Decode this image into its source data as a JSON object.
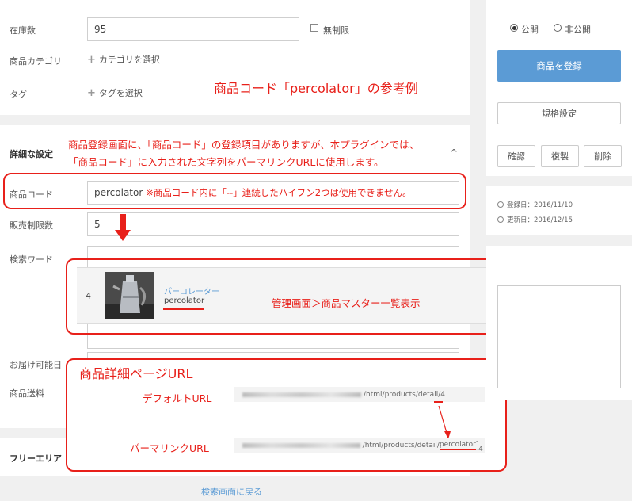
{
  "form": {
    "stock_label": "在庫数",
    "stock_value": "95",
    "unlimited_label": "無制限",
    "category_label": "商品カテゴリ",
    "category_link": "カテゴリを選択",
    "tag_label": "タグ",
    "tag_link": "タグを選択",
    "detail_section_title": "詳細な設定",
    "product_code_label": "商品コード",
    "product_code_value": "percolator",
    "sale_limit_label": "販売制限数",
    "sale_limit_value": "5",
    "search_word_label": "検索ワード",
    "delivery_label": "お届け可能日",
    "shipping_label": "商品送料",
    "free_area_label": "フリーエリア",
    "back_link": "検索画面に戻る"
  },
  "sidebar": {
    "public_label": "公開",
    "private_label": "非公開",
    "register_button": "商品を登録",
    "spec_button": "規格設定",
    "confirm_button": "確認",
    "copy_button": "複製",
    "delete_button": "削除",
    "created_label": "登録日：2016/11/10",
    "updated_label": "更新日：2016/12/15"
  },
  "product_row": {
    "id": "4",
    "name": "パーコレーター",
    "code": "percolator",
    "menu": "•••"
  },
  "annotations": {
    "title": "商品コード「percolator」の参考例",
    "explain_line1": "商品登録画面に、「商品コード」の登録項目がありますが、本プラグインでは、",
    "explain_line2": "「商品コード」に入力された文字列をパーマリンクURLに使用します。",
    "warning": "※商品コード内に「--」連続したハイフン2つは使用できません。",
    "list_note": "管理画面＞商品マスター一覧表示",
    "url_heading": "商品詳細ページURL",
    "default_url_label": "デフォルトURL",
    "permalink_url_label": "パーマリンクURL",
    "default_url_path": "/html/products/detail/",
    "default_url_id": "4",
    "permalink_url_path": "/html/products/detail/",
    "permalink_url_code": "percolator",
    "permalink_url_suffix": "--4"
  },
  "colors": {
    "accent": "#5b9bd5",
    "annotation_red": "#e8201a"
  }
}
